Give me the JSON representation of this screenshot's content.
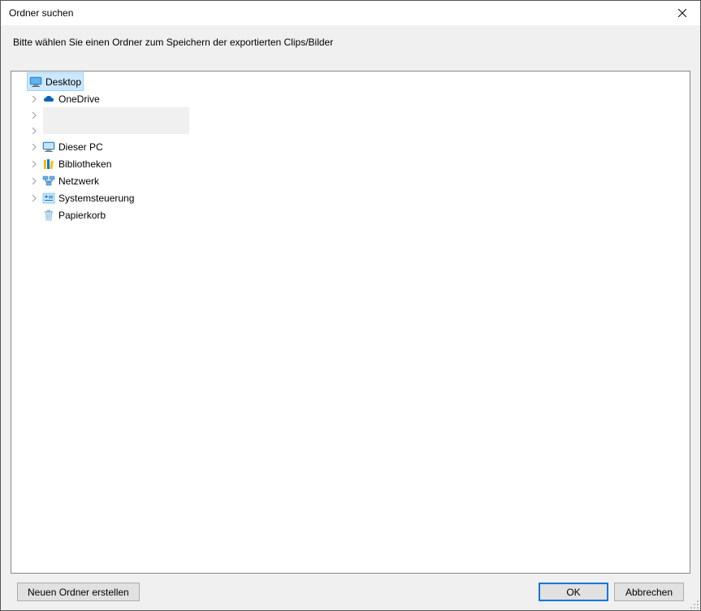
{
  "window": {
    "title": "Ordner suchen"
  },
  "instruction": "Bitte wählen Sie einen Ordner zum Speichern der exportierten Clips/Bilder",
  "tree": {
    "items": [
      {
        "label": "Desktop",
        "icon": "desktop",
        "expandable": false,
        "selected": true,
        "indent": 0
      },
      {
        "label": "OneDrive",
        "icon": "onedrive",
        "expandable": true,
        "selected": false,
        "indent": 1
      },
      {
        "label": "",
        "icon": "redacted",
        "expandable": true,
        "selected": false,
        "indent": 1
      },
      {
        "label": "",
        "icon": "redacted",
        "expandable": true,
        "selected": false,
        "indent": 1
      },
      {
        "label": "Dieser PC",
        "icon": "thispc",
        "expandable": true,
        "selected": false,
        "indent": 1
      },
      {
        "label": "Bibliotheken",
        "icon": "libraries",
        "expandable": true,
        "selected": false,
        "indent": 1
      },
      {
        "label": "Netzwerk",
        "icon": "network",
        "expandable": true,
        "selected": false,
        "indent": 1
      },
      {
        "label": "Systemsteuerung",
        "icon": "controlpanel",
        "expandable": true,
        "selected": false,
        "indent": 1
      },
      {
        "label": "Papierkorb",
        "icon": "recyclebin",
        "expandable": false,
        "selected": false,
        "indent": 1
      }
    ]
  },
  "buttons": {
    "new_folder": "Neuen Ordner erstellen",
    "ok": "OK",
    "cancel": "Abbrechen"
  }
}
